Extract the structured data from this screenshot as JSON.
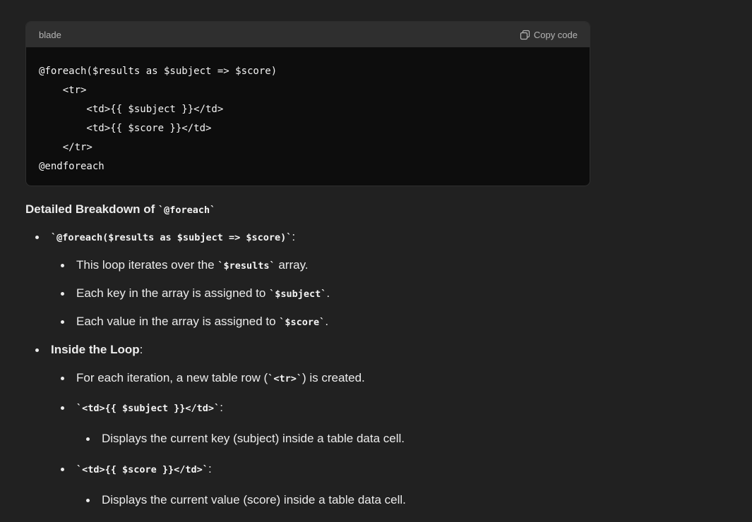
{
  "code_block": {
    "language": "blade",
    "copy_label": "Copy code",
    "lines": [
      "@foreach($results as $subject => $score)",
      "    <tr>",
      "        <td>{{ $subject }}</td>",
      "        <td>{{ $score }}</td>",
      "    </tr>",
      "@endforeach"
    ]
  },
  "breakdown": {
    "heading_text": "Detailed Breakdown of ",
    "heading_code": "`@foreach`",
    "item1": {
      "code": "`@foreach($results as $subject => $score)`",
      "suffix": ":",
      "sub1_pre": "This loop iterates over the ",
      "sub1_code": "`$results`",
      "sub1_post": " array.",
      "sub2_pre": "Each key in the array is assigned to ",
      "sub2_code": "`$subject`",
      "sub2_post": ".",
      "sub3_pre": "Each value in the array is assigned to ",
      "sub3_code": "`$score`",
      "sub3_post": "."
    },
    "item2": {
      "label": "Inside the Loop",
      "suffix": ":",
      "sub1_pre": "For each iteration, a new table row (",
      "sub1_code": "`<tr>`",
      "sub1_post": ") is created.",
      "sub2_code": "`<td>{{ $subject }}</td>`",
      "sub2_suffix": ":",
      "sub2_detail": "Displays the current key (subject) inside a table data cell.",
      "sub3_code": "`<td>{{ $score }}</td>`",
      "sub3_suffix": ":",
      "sub3_detail": "Displays the current value (score) inside a table data cell."
    }
  }
}
